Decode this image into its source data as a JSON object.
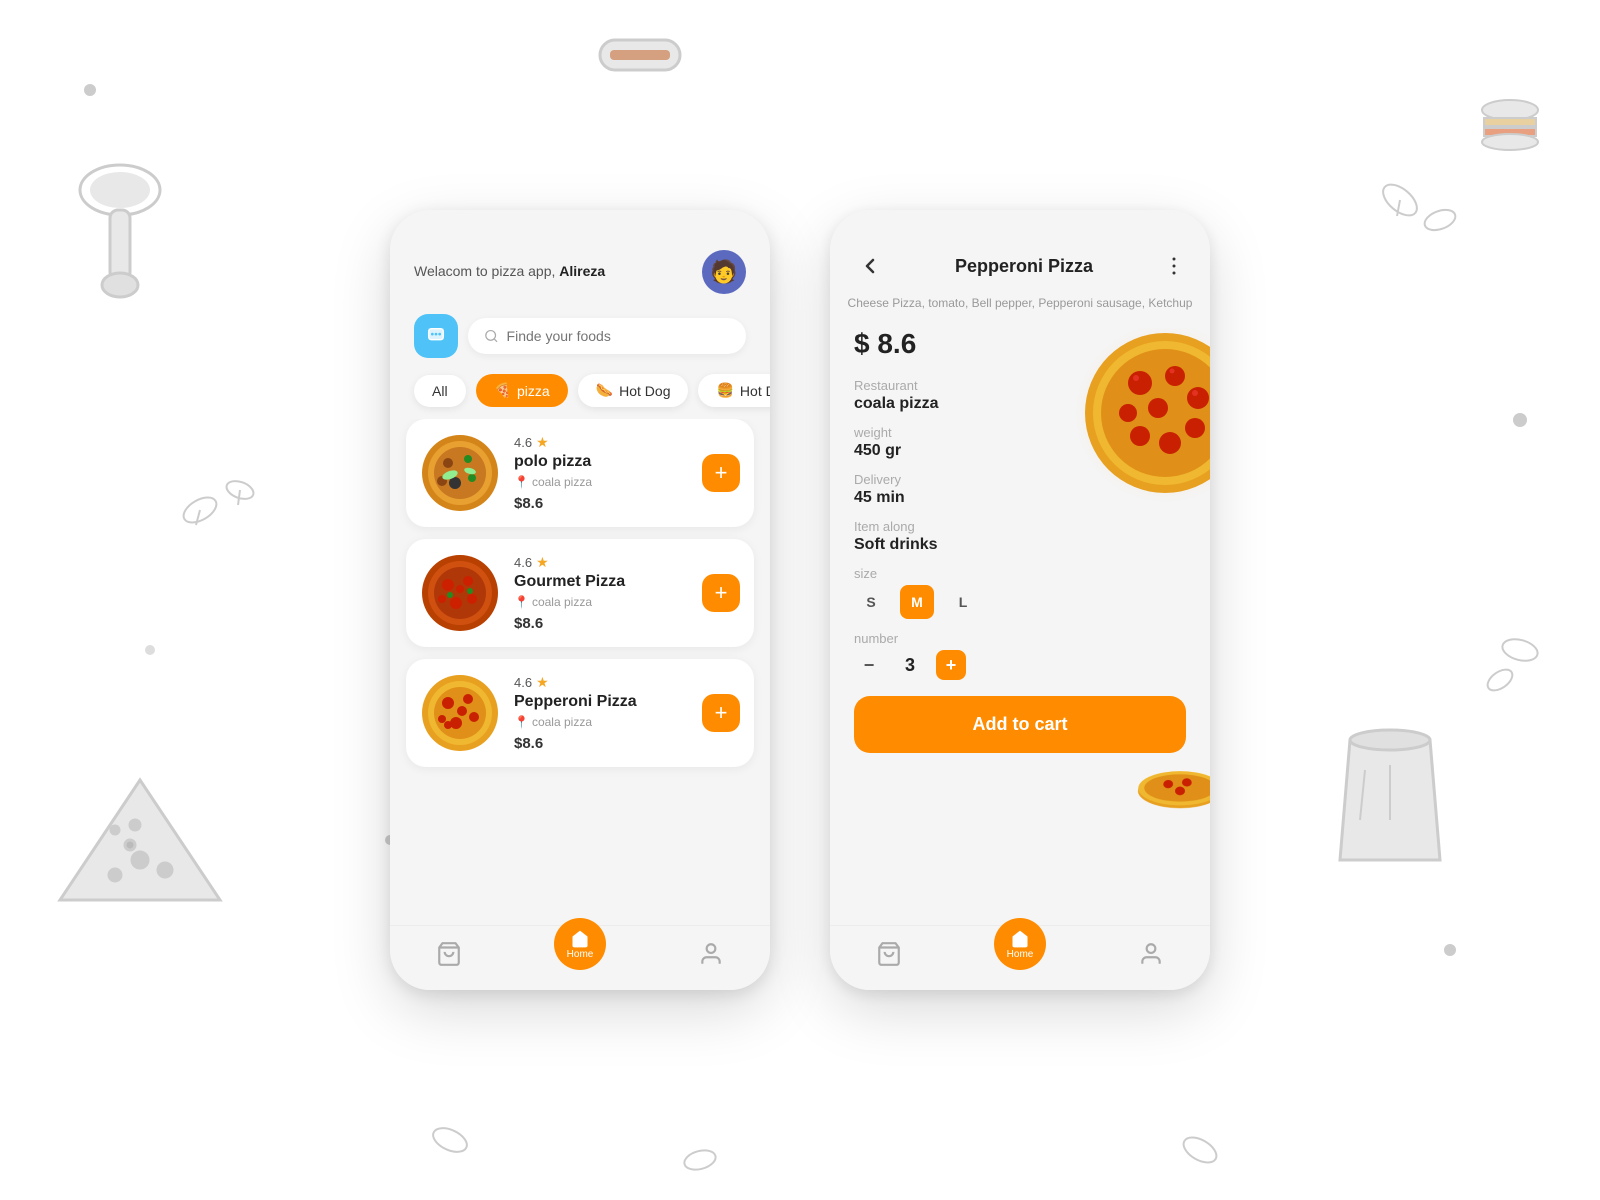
{
  "app": {
    "name": "Pizza App"
  },
  "background": {
    "color": "#ffffff"
  },
  "left_phone": {
    "header": {
      "welcome_text": "Welacom to pizza app,",
      "username": "Alireza"
    },
    "search": {
      "placeholder": "Finde your foods"
    },
    "categories": [
      {
        "id": "all",
        "label": "All",
        "active": false,
        "emoji": ""
      },
      {
        "id": "pizza",
        "label": "pizza",
        "active": true,
        "emoji": "🍕"
      },
      {
        "id": "hotdog1",
        "label": "Hot Dog",
        "active": false,
        "emoji": "🌭"
      },
      {
        "id": "hotdog2",
        "label": "Hot Dog",
        "active": false,
        "emoji": "🍔"
      }
    ],
    "food_items": [
      {
        "id": 1,
        "name": "polo pizza",
        "restaurant": "coala pizza",
        "rating": "4.6",
        "price": "$8.6",
        "color1": "#c8860a",
        "color2": "#e8a020"
      },
      {
        "id": 2,
        "name": "Gourmet Pizza",
        "restaurant": "coala pizza",
        "rating": "4.6",
        "price": "$8.6",
        "color1": "#8b2000",
        "color2": "#c43010"
      },
      {
        "id": 3,
        "name": "Pepperoni Pizza",
        "restaurant": "coala pizza",
        "rating": "4.6",
        "price": "$8.6",
        "color1": "#c83010",
        "color2": "#e84020"
      }
    ],
    "nav": {
      "cart_label": "",
      "home_label": "Home",
      "profile_label": ""
    }
  },
  "right_phone": {
    "header": {
      "title": "Pepperoni Pizza",
      "back": "‹",
      "more": "⋮"
    },
    "subtitle": "Cheese Pizza, tomato, Bell pepper,\nPepperoni sausage, Ketchup",
    "price": "$ 8.6",
    "details": {
      "restaurant_label": "Restaurant",
      "restaurant_value": "coala pizza",
      "weight_label": "weight",
      "weight_value": "450 gr",
      "delivery_label": "Delivery",
      "delivery_value": "45 min",
      "item_along_label": "Item along",
      "item_along_value": "Soft drinks",
      "size_label": "size",
      "sizes": [
        "S",
        "M",
        "L"
      ],
      "active_size": "M",
      "number_label": "number",
      "quantity": "3"
    },
    "add_to_cart": "Add to cart",
    "nav": {
      "cart_label": "",
      "home_label": "Home",
      "profile_label": ""
    }
  }
}
